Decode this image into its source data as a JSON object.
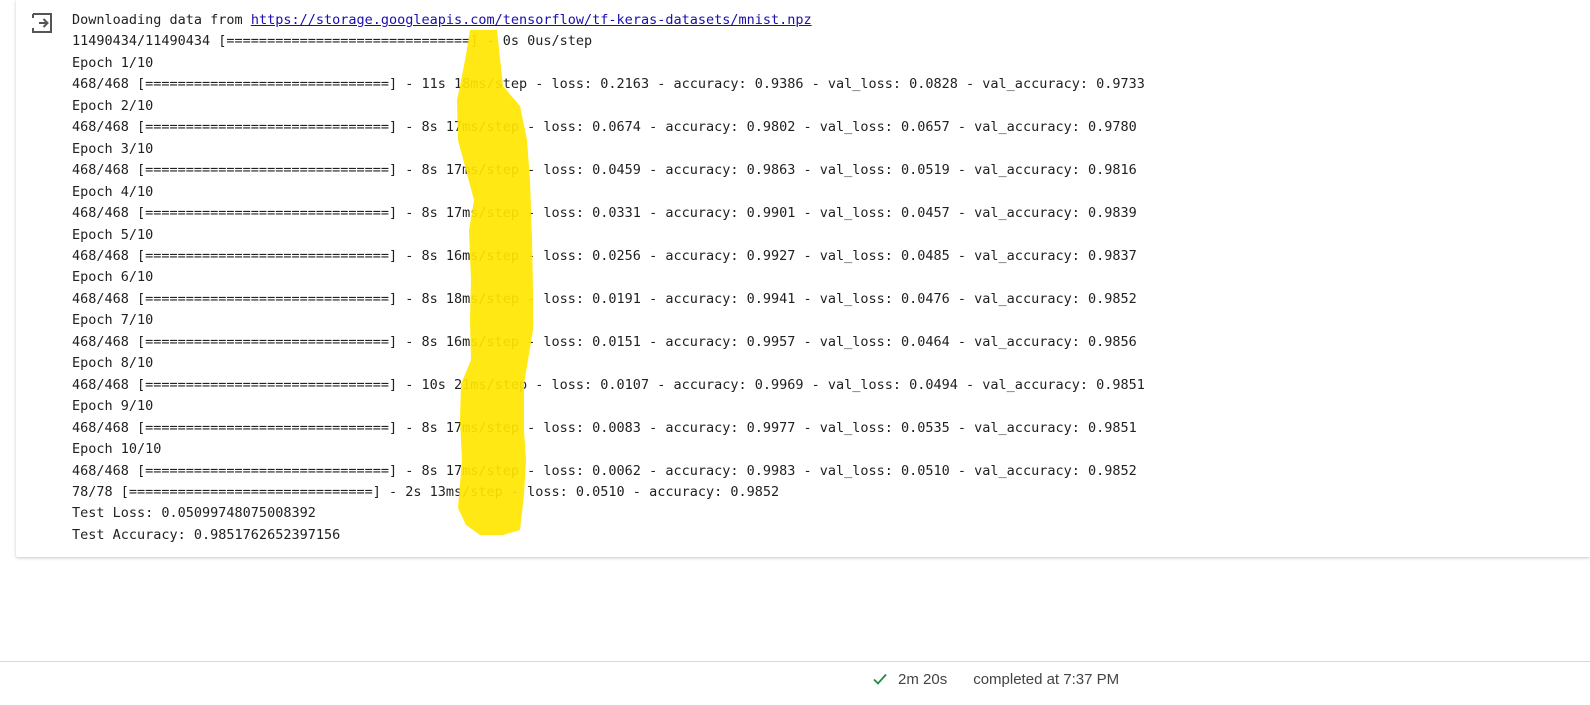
{
  "output": {
    "download_prefix": "Downloading data from ",
    "download_url": "https://storage.googleapis.com/tensorflow/tf-keras-datasets/mnist.npz",
    "download_progress": "11490434/11490434 [==============================] - 0s 0us/step",
    "epochs": [
      {
        "header": "Epoch 1/10",
        "line": "468/468 [==============================] - 11s 18ms/step - loss: 0.2163 - accuracy: 0.9386 - val_loss: 0.0828 - val_accuracy: 0.9733"
      },
      {
        "header": "Epoch 2/10",
        "line": "468/468 [==============================] - 8s 17ms/step - loss: 0.0674 - accuracy: 0.9802 - val_loss: 0.0657 - val_accuracy: 0.9780"
      },
      {
        "header": "Epoch 3/10",
        "line": "468/468 [==============================] - 8s 17ms/step - loss: 0.0459 - accuracy: 0.9863 - val_loss: 0.0519 - val_accuracy: 0.9816"
      },
      {
        "header": "Epoch 4/10",
        "line": "468/468 [==============================] - 8s 17ms/step - loss: 0.0331 - accuracy: 0.9901 - val_loss: 0.0457 - val_accuracy: 0.9839"
      },
      {
        "header": "Epoch 5/10",
        "line": "468/468 [==============================] - 8s 16ms/step - loss: 0.0256 - accuracy: 0.9927 - val_loss: 0.0485 - val_accuracy: 0.9837"
      },
      {
        "header": "Epoch 6/10",
        "line": "468/468 [==============================] - 8s 18ms/step - loss: 0.0191 - accuracy: 0.9941 - val_loss: 0.0476 - val_accuracy: 0.9852"
      },
      {
        "header": "Epoch 7/10",
        "line": "468/468 [==============================] - 8s 16ms/step - loss: 0.0151 - accuracy: 0.9957 - val_loss: 0.0464 - val_accuracy: 0.9856"
      },
      {
        "header": "Epoch 8/10",
        "line": "468/468 [==============================] - 10s 21ms/step - loss: 0.0107 - accuracy: 0.9969 - val_loss: 0.0494 - val_accuracy: 0.9851"
      },
      {
        "header": "Epoch 9/10",
        "line": "468/468 [==============================] - 8s 17ms/step - loss: 0.0083 - accuracy: 0.9977 - val_loss: 0.0535 - val_accuracy: 0.9851"
      },
      {
        "header": "Epoch 10/10",
        "line": "468/468 [==============================] - 8s 17ms/step - loss: 0.0062 - accuracy: 0.9983 - val_loss: 0.0510 - val_accuracy: 0.9852"
      }
    ],
    "evaluate_line": "78/78 [==============================] - 2s 13ms/step - loss: 0.0510 - accuracy: 0.9852",
    "test_loss": "Test Loss: 0.05099748075008392",
    "test_accuracy": "Test Accuracy: 0.9851762652397156"
  },
  "status": {
    "icon": "check-icon",
    "duration": "2m 20s",
    "completed": "completed at 7:37 PM"
  },
  "colors": {
    "highlight": "#ffe600",
    "link": "#1a0dab",
    "check": "#1e8e3e"
  },
  "icons": {
    "output_toggle": "output-redirect-icon"
  }
}
